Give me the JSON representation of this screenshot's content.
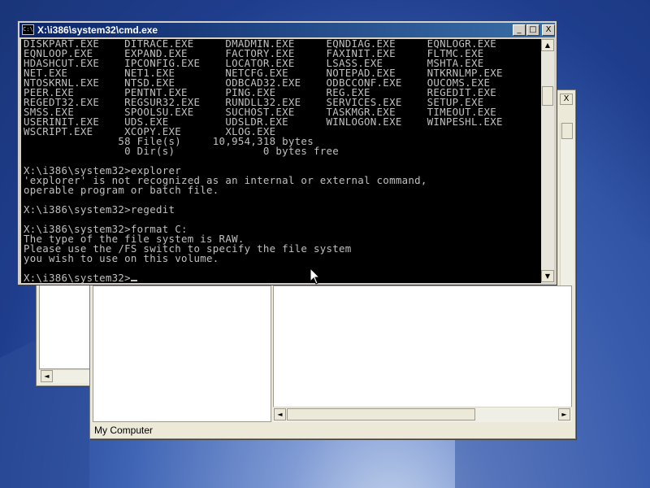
{
  "desktop": {
    "wallpaper_colors": [
      "#1a3578",
      "#3f64b4",
      "#c9d8ef"
    ]
  },
  "explorer": {
    "status_text": "My Computer"
  },
  "cmd": {
    "title": "X:\\i386\\system32\\cmd.exe",
    "icon_text": "C:\\",
    "buttons": {
      "minimize": "_",
      "maximize": "□",
      "close": "X"
    },
    "console_lines": [
      "DISKPART.EXE    DITRACE.EXE     DMADMIN.EXE     EQNDIAG.EXE     EQNLOGR.EXE",
      "EQNLOOP.EXE     EXPAND.EXE      FACTORY.EXE     FAXINIT.EXE     FLTMC.EXE",
      "HDASHCUT.EXE    IPCONFIG.EXE    LOCATOR.EXE     LSASS.EXE       MSHTA.EXE",
      "NET.EXE         NET1.EXE        NETCFG.EXE      NOTEPAD.EXE     NTKRNLMP.EXE",
      "NTOSKRNL.EXE    NTSD.EXE        ODBCAD32.EXE    ODBCCONF.EXE    OUCOMS.EXE",
      "PEER.EXE        PENTNT.EXE      PING.EXE        REG.EXE         REGEDIT.EXE",
      "REGEDT32.EXE    REGSUR32.EXE    RUNDLL32.EXE    SERVICES.EXE    SETUP.EXE",
      "SMSS.EXE        SPOOLSU.EXE     SUCHOST.EXE     TASKMGR.EXE     TIMEOUT.EXE",
      "USERINIT.EXE    UDS.EXE         UDSLDR.EXE      WINLOGON.EXE    WINPESHL.EXE",
      "WSCRIPT.EXE     XCOPY.EXE       XLOG.EXE",
      "               58 File(s)     10,954,318 bytes",
      "                0 Dir(s)              0 bytes free",
      "",
      "X:\\i386\\system32>explorer",
      "'explorer' is not recognized as an internal or external command,",
      "operable program or batch file.",
      "",
      "X:\\i386\\system32>regedit",
      "",
      "X:\\i386\\system32>format C:",
      "The type of the file system is RAW.",
      "Please use the /FS switch to specify the file system",
      "you wish to use on this volume.",
      "",
      "X:\\i386\\system32>"
    ]
  }
}
